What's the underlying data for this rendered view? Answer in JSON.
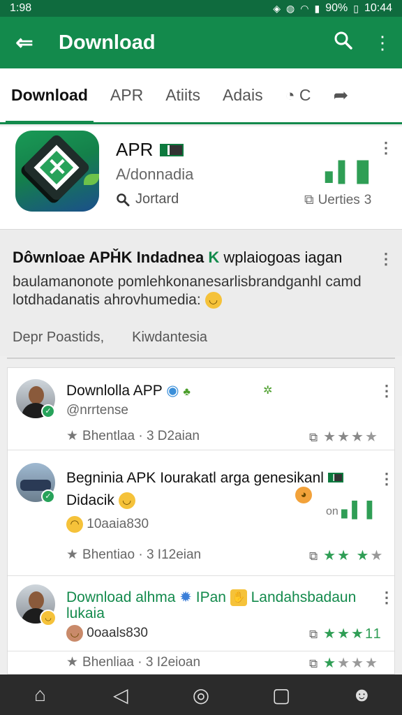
{
  "status_bar": {
    "left": "1:98",
    "battery": "90%",
    "time": "10:44"
  },
  "app_bar": {
    "title": "Download"
  },
  "tabs": [
    {
      "label": "Download"
    },
    {
      "label": "APR"
    },
    {
      "label": "Atiits"
    },
    {
      "label": "Adais"
    },
    {
      "label": "C"
    }
  ],
  "app_card": {
    "name": "APR",
    "subtitle": "A/donnadia",
    "search_label": "Jortard",
    "stat_label": "Uerties",
    "stat_count": "3"
  },
  "feature": {
    "heading_bold": "Dôwnloae APȞK Indadnea",
    "heading_accent": "K",
    "heading_rest": "wplaiogoas iagan",
    "line2": "baulamanonote pomlehkonanesarlisbrandganhl camd",
    "line3": "lotdhadanatis ahrovhumedia:",
    "link1": "Depr Poastids,",
    "link2": "Kiwdantesia"
  },
  "list": [
    {
      "title": "Downlolla APP",
      "subtitle": "@nrrtense",
      "meta": "Bhentlaa · 3 D2aian",
      "stars_on": 3
    },
    {
      "title": "Begninia APK Iourakatl arga genesikanl",
      "subtitle": "Didacik",
      "extra": "10aaia830",
      "side_text": "on",
      "meta": "Bhentiao · 3 I12eian",
      "stars_on": 3
    },
    {
      "title": "Download alhma",
      "title_mid": "IPan",
      "title_end": "Landahsbadaun",
      "title_line2": "lukaia",
      "subtitle": "0oaals830",
      "rating_end": "11",
      "stars_on": 3
    },
    {
      "meta": "Bhenliaa · 3 I2eioan",
      "stars_on": 1
    }
  ],
  "colors": {
    "primary": "#138a4c",
    "status_bar": "#0f6b3e",
    "accent_green": "#2f9e55",
    "nav_bar": "#2b2b2b"
  }
}
